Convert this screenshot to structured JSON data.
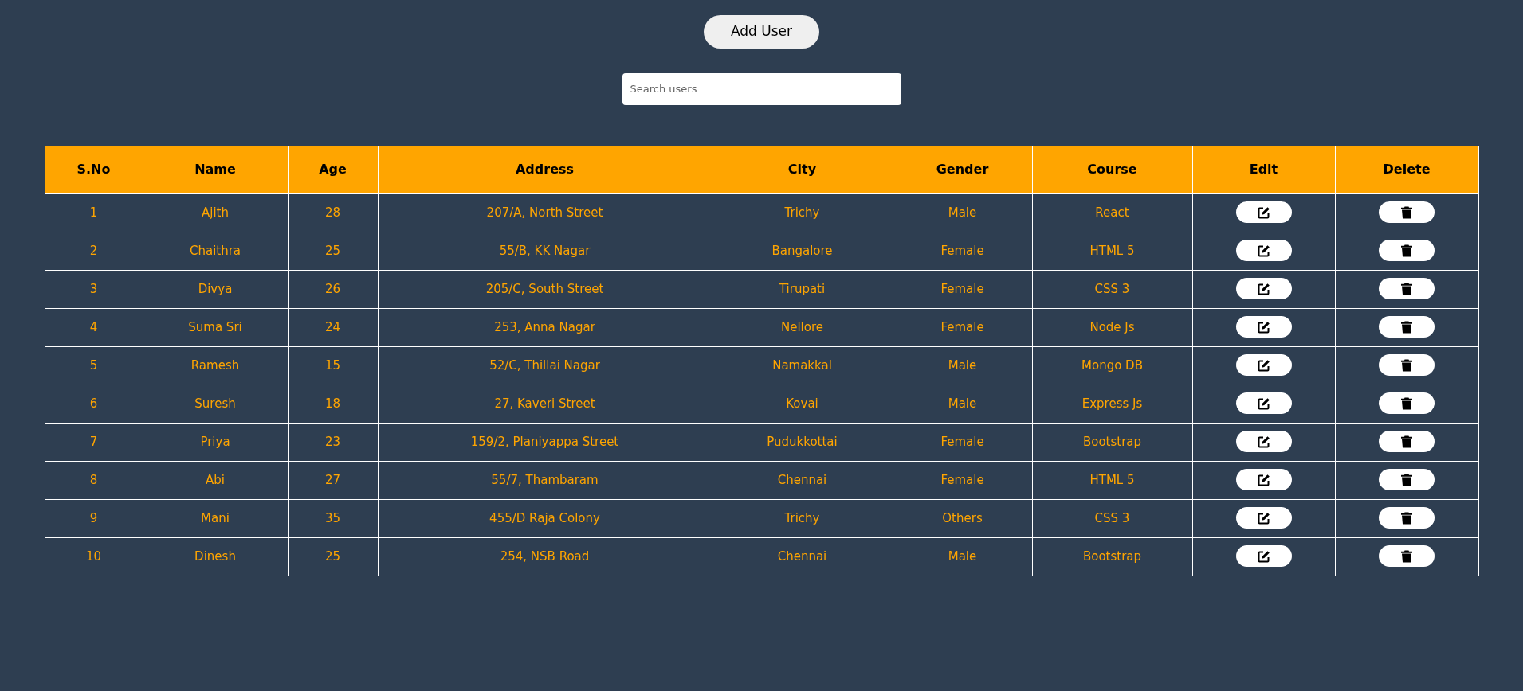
{
  "add_button": "Add User",
  "search": {
    "placeholder": "Search users"
  },
  "table": {
    "columns": [
      "S.No",
      "Name",
      "Age",
      "Address",
      "City",
      "Gender",
      "Course",
      "Edit",
      "Delete"
    ],
    "rows": [
      {
        "sno": "1",
        "name": "Ajith",
        "age": "28",
        "address": "207/A, North Street",
        "city": "Trichy",
        "gender": "Male",
        "course": "React"
      },
      {
        "sno": "2",
        "name": "Chaithra",
        "age": "25",
        "address": "55/B, KK Nagar",
        "city": "Bangalore",
        "gender": "Female",
        "course": "HTML 5"
      },
      {
        "sno": "3",
        "name": "Divya",
        "age": "26",
        "address": "205/C, South Street",
        "city": "Tirupati",
        "gender": "Female",
        "course": "CSS 3"
      },
      {
        "sno": "4",
        "name": "Suma Sri",
        "age": "24",
        "address": "253, Anna Nagar",
        "city": "Nellore",
        "gender": "Female",
        "course": "Node Js"
      },
      {
        "sno": "5",
        "name": "Ramesh",
        "age": "15",
        "address": "52/C, Thillai Nagar",
        "city": "Namakkal",
        "gender": "Male",
        "course": "Mongo DB"
      },
      {
        "sno": "6",
        "name": "Suresh",
        "age": "18",
        "address": "27, Kaveri Street",
        "city": "Kovai",
        "gender": "Male",
        "course": "Express Js"
      },
      {
        "sno": "7",
        "name": "Priya",
        "age": "23",
        "address": "159/2, Planiyappa Street",
        "city": "Pudukkottai",
        "gender": "Female",
        "course": "Bootstrap"
      },
      {
        "sno": "8",
        "name": "Abi",
        "age": "27",
        "address": "55/7, Thambaram",
        "city": "Chennai",
        "gender": "Female",
        "course": "HTML 5"
      },
      {
        "sno": "9",
        "name": "Mani",
        "age": "35",
        "address": "455/D Raja Colony",
        "city": "Trichy",
        "gender": "Others",
        "course": "CSS 3"
      },
      {
        "sno": "10",
        "name": "Dinesh",
        "age": "25",
        "address": "254, NSB Road",
        "city": "Chennai",
        "gender": "Male",
        "course": "Bootstrap"
      }
    ]
  }
}
